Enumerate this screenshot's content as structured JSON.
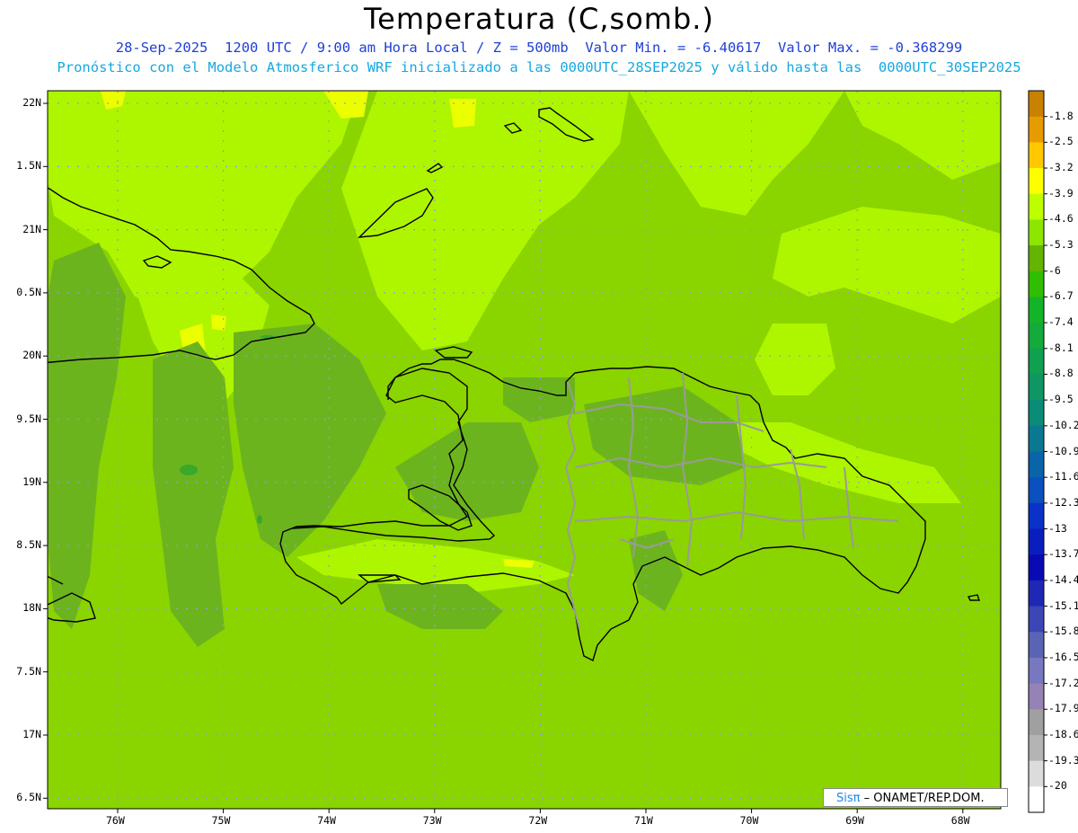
{
  "header": {
    "title": "Temperatura (C,somb.)",
    "line1": "28-Sep-2025  1200 UTC / 9:00 am Hora Local / Z = 500mb  Valor Min. = -6.40617  Valor Max. = -0.368299",
    "line2": "Pronóstico con el Modelo Atmosferico WRF inicializado a las 0000UTC_28SEP2025 y válido hasta las  0000UTC_30SEP2025"
  },
  "axes": {
    "y_labels": [
      "22N",
      "1.5N",
      "21N",
      "0.5N",
      "20N",
      "9.5N",
      "19N",
      "8.5N",
      "18N",
      "7.5N",
      "17N",
      "6.5N"
    ],
    "x_labels": [
      "76W",
      "75W",
      "74W",
      "73W",
      "72W",
      "71W",
      "70W",
      "69W",
      "68W"
    ],
    "lat_range": [
      16.5,
      22.1
    ],
    "lon_range": [
      -76.65,
      -67.6
    ]
  },
  "colorbar": {
    "labels": [
      "-1.8",
      "-2.5",
      "-3.2",
      "-3.9",
      "-4.6",
      "-5.3",
      "-6",
      "-6.7",
      "-7.4",
      "-8.1",
      "-8.8",
      "-9.5",
      "-10.2",
      "-10.9",
      "-11.6",
      "-12.3",
      "-13",
      "-13.7",
      "-14.4",
      "-15.1",
      "-15.8",
      "-16.5",
      "-17.2",
      "-17.9",
      "-18.6",
      "-19.3",
      "-20"
    ],
    "colors": [
      "#c88200",
      "#e69b00",
      "#ffc800",
      "#ffff00",
      "#beff00",
      "#8ce600",
      "#64b400",
      "#32be00",
      "#14b428",
      "#14aa3c",
      "#0fa050",
      "#0f9664",
      "#0a8c78",
      "#0a7891",
      "#0a64aa",
      "#0a50be",
      "#0a32c8",
      "#0a1ebe",
      "#0a0ab4",
      "#1e28b4",
      "#3c46b4",
      "#5a64b4",
      "#7878c0",
      "#9682b4",
      "#a0a0a0",
      "#b4b4b4",
      "#dcdcdc",
      "#ffffff"
    ]
  },
  "field_colors": {
    "base": "#8ad400",
    "warm": "#aef500",
    "warmer": "#ecff00",
    "cool": "#6cb41e",
    "coolest": "#3aa82a"
  },
  "credit": {
    "brand": "Sisπ",
    "text": " – ONAMET/REP.DOM."
  }
}
